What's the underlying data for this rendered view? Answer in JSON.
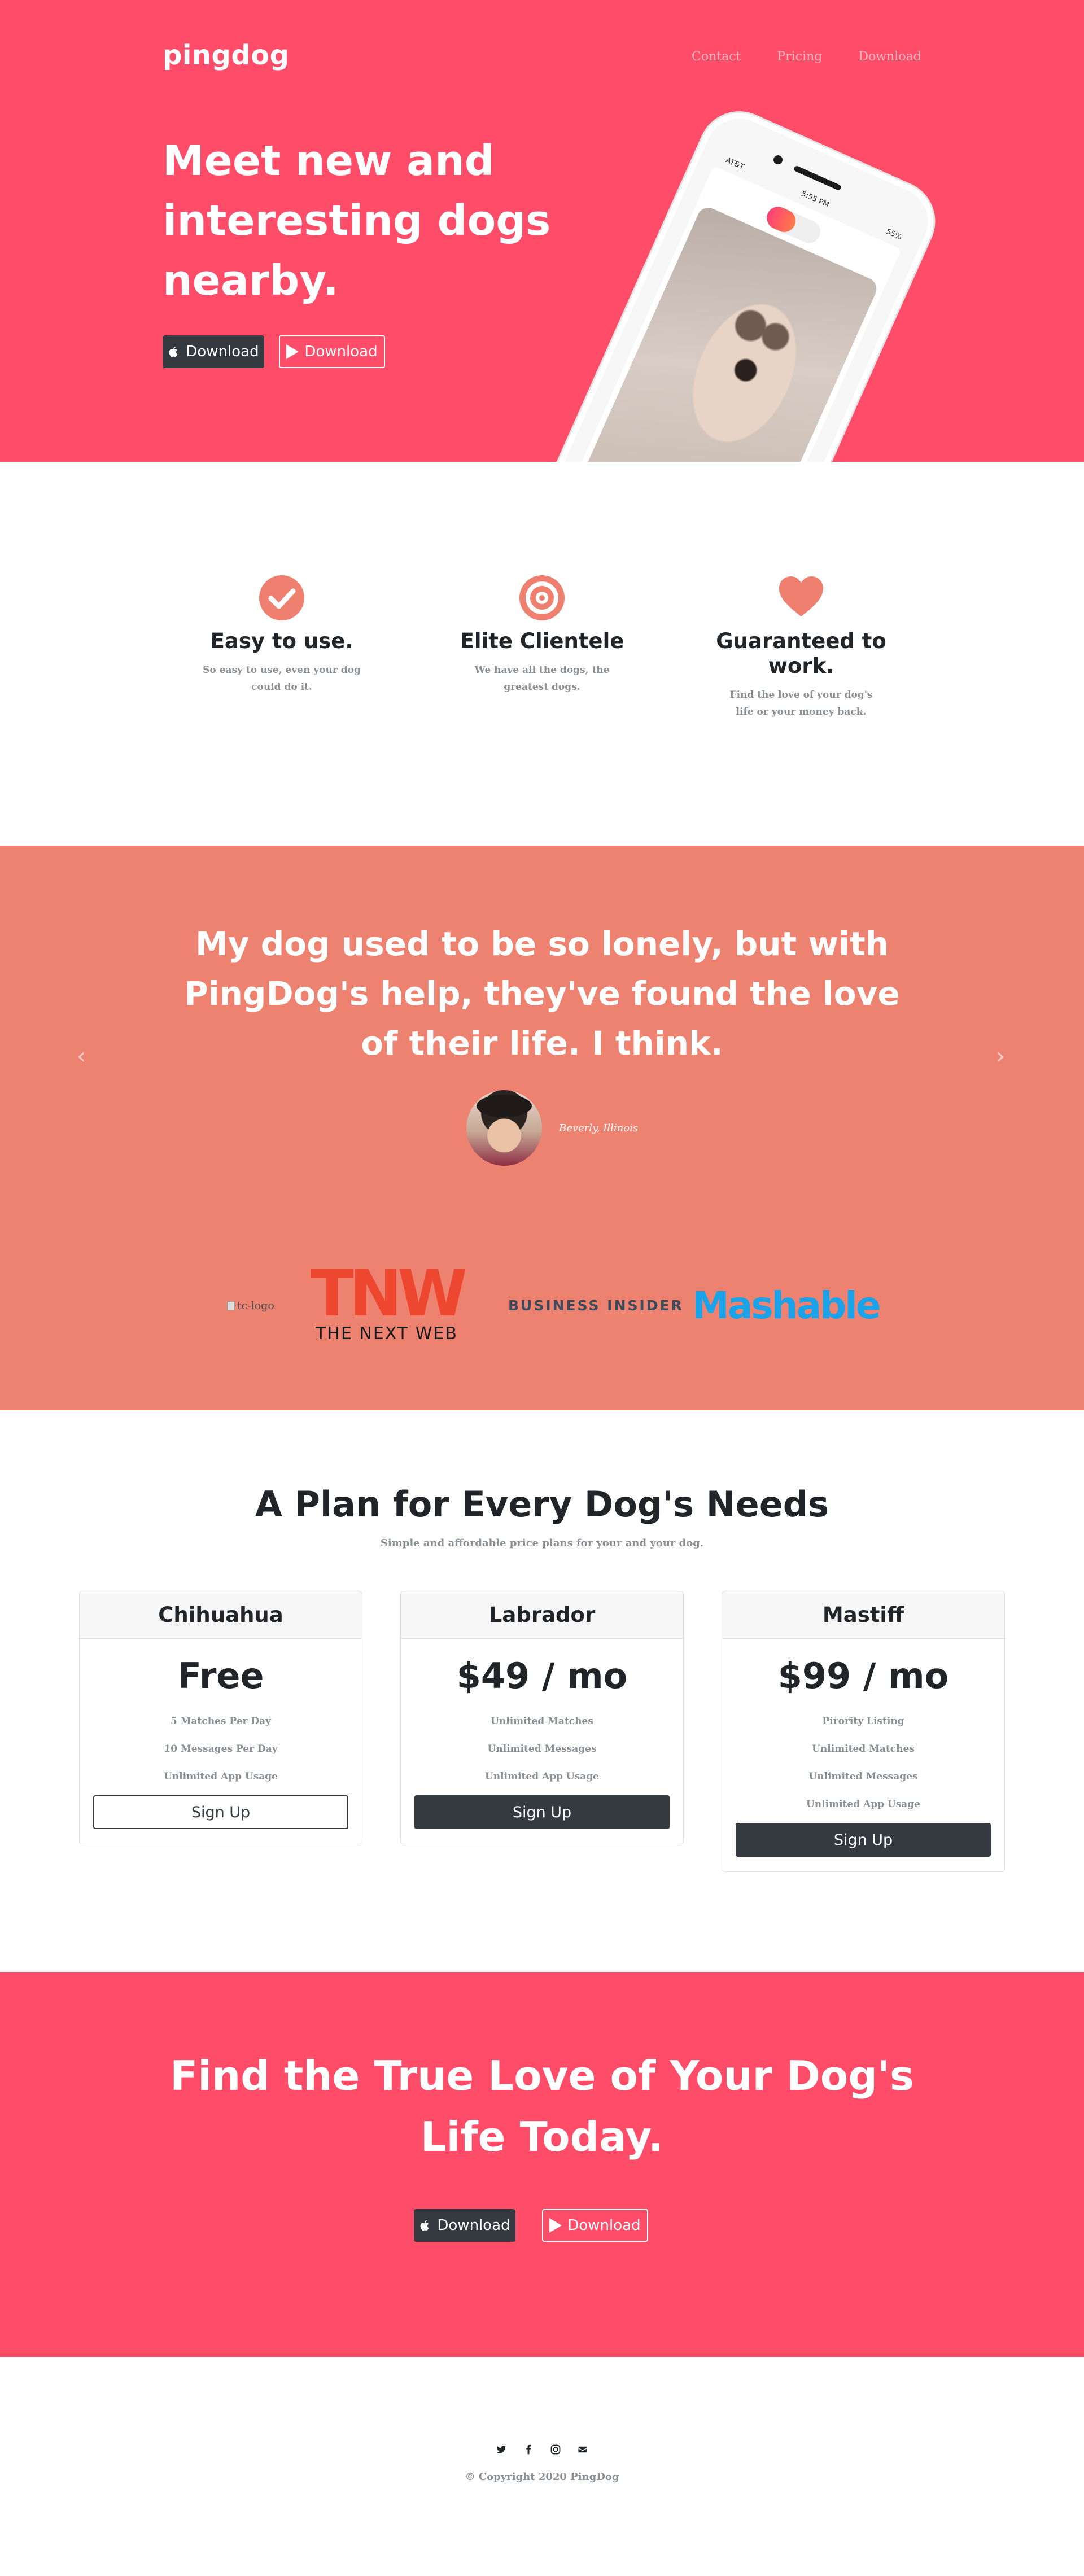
{
  "brand": "pingdog",
  "nav": {
    "items": [
      "Contact",
      "Pricing",
      "Download"
    ]
  },
  "hero": {
    "title": "Meet new and interesting dogs nearby.",
    "download_apple": "Download",
    "download_play": "Download",
    "phone_status": {
      "carrier": "AT&T",
      "time": "5:55 PM",
      "battery": "55%"
    }
  },
  "features": [
    {
      "icon": "check-circle-icon",
      "title": "Easy to use.",
      "text": "So easy to use, even your dog could do it."
    },
    {
      "icon": "bullseye-icon",
      "title": "Elite Clientele",
      "text": "We have all the dogs, the greatest dogs."
    },
    {
      "icon": "heart-icon",
      "title": "Guaranteed to work.",
      "text": "Find the love of your dog's life or your money back."
    }
  ],
  "testimonial": {
    "quote": "My dog used to be so lonely, but with PingDog's help, they've found the love of their life. I think.",
    "author": "Beverly, Illinois",
    "prev_icon": "chevron-left-icon",
    "next_icon": "chevron-right-icon"
  },
  "logos": {
    "tc_alt": "tc-logo",
    "tnw_mark": "TNW",
    "tnw_name": "THE NEXT WEB",
    "business_insider": "BUSINESS INSIDER",
    "mashable": "Mashable"
  },
  "pricing": {
    "title": "A Plan for Every Dog's Needs",
    "subtitle": "Simple and affordable price plans for your and your dog.",
    "plans": [
      {
        "name": "Chihuahua",
        "price": "Free",
        "features": [
          "5 Matches Per Day",
          "10 Messages Per Day",
          "Unlimited App Usage"
        ],
        "button": "Sign Up",
        "button_style": "outline"
      },
      {
        "name": "Labrador",
        "price": "$49 / mo",
        "features": [
          "Unlimited Matches",
          "Unlimited Messages",
          "Unlimited App Usage"
        ],
        "button": "Sign Up",
        "button_style": "solid"
      },
      {
        "name": "Mastiff",
        "price": "$99 / mo",
        "features": [
          "Pirority Listing",
          "Unlimited Matches",
          "Unlimited Messages",
          "Unlimited App Usage"
        ],
        "button": "Sign Up",
        "button_style": "solid"
      }
    ]
  },
  "cta": {
    "title": "Find the True Love of Your Dog's Life Today.",
    "download_apple": "Download",
    "download_play": "Download"
  },
  "footer": {
    "social_icons": [
      "twitter-icon",
      "facebook-icon",
      "instagram-icon",
      "envelope-icon"
    ],
    "copyright": "© Copyright 2020 PingDog"
  },
  "colors": {
    "hero_bg": "#ff4c68",
    "testimonial_bg": "#ee8270",
    "accent_icon": "#ef7f6e",
    "dark_button": "#343a40",
    "mashable_blue": "#1aa3e8",
    "tnw_red": "#ed4730"
  }
}
